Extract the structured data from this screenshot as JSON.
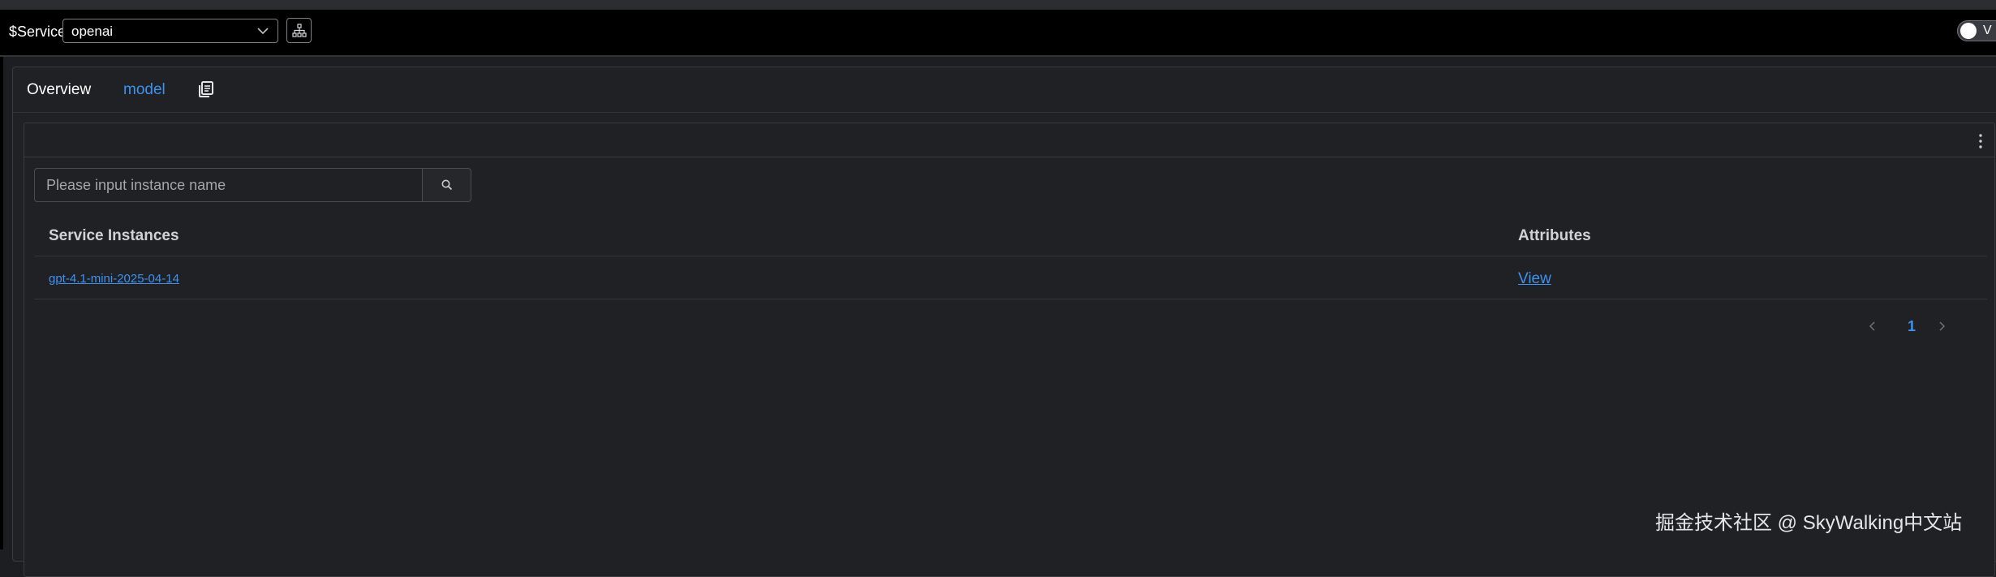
{
  "toolbar": {
    "service_label": "$Service",
    "service_value": "openai",
    "toggle_text": "V"
  },
  "tabs": [
    {
      "label": "Overview"
    },
    {
      "label": "model"
    }
  ],
  "widget": {
    "search_placeholder": "Please input instance name",
    "columns": [
      "Service Instances",
      "Attributes"
    ],
    "rows": [
      {
        "instance": "gpt-4.1-mini-2025-04-14",
        "attributes": "View"
      }
    ],
    "pagination": {
      "current_page": "1"
    }
  },
  "watermark": "掘金技术社区 @ SkyWalking中文站",
  "colors": {
    "accent": "#3d92f0",
    "background": "#1d1e21",
    "toolbar": "#000000"
  },
  "icons": [
    "chevron-down-icon",
    "topology-icon",
    "copy-icon",
    "kebab-menu-icon",
    "search-icon",
    "chevron-left-icon",
    "chevron-right-icon"
  ]
}
